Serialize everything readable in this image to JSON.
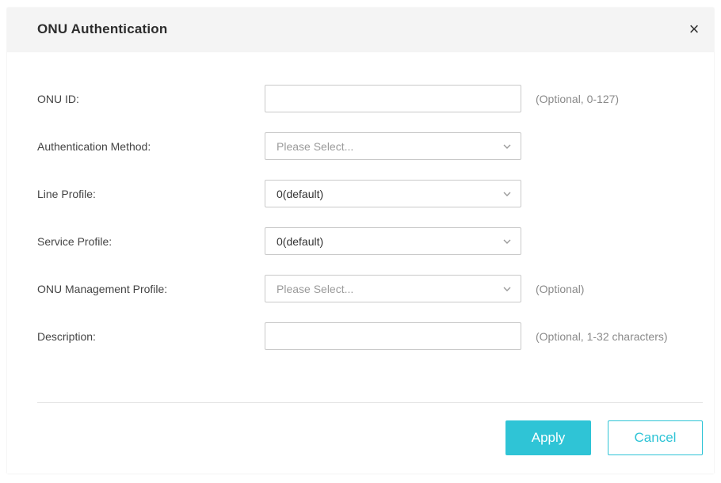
{
  "dialog": {
    "title": "ONU Authentication",
    "close_symbol": "×"
  },
  "fields": [
    {
      "label": "ONU ID:",
      "type": "input",
      "value": "",
      "placeholder": "",
      "hint": "(Optional, 0-127)"
    },
    {
      "label": "Authentication Method:",
      "type": "select",
      "value": "Please Select...",
      "is_placeholder": true,
      "hint": ""
    },
    {
      "label": "Line Profile:",
      "type": "select",
      "value": "0(default)",
      "is_placeholder": false,
      "hint": ""
    },
    {
      "label": "Service Profile:",
      "type": "select",
      "value": "0(default)",
      "is_placeholder": false,
      "hint": ""
    },
    {
      "label": "ONU Management Profile:",
      "type": "select",
      "value": "Please Select...",
      "is_placeholder": true,
      "hint": "(Optional)"
    },
    {
      "label": "Description:",
      "type": "input",
      "value": "",
      "placeholder": "",
      "hint": "(Optional, 1-32 characters)"
    }
  ],
  "buttons": {
    "apply_label": "Apply",
    "cancel_label": "Cancel"
  },
  "colors": {
    "accent": "#2fc4d6",
    "header_bg": "#f4f4f4"
  },
  "icons": {
    "close": "close-icon",
    "dropdown": "chevron-down-icon"
  }
}
